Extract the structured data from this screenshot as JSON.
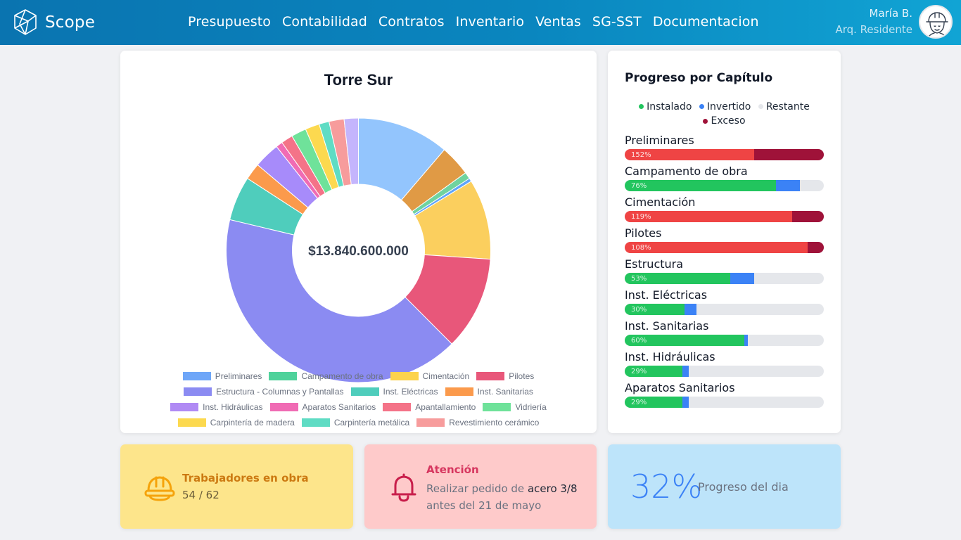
{
  "app": {
    "name": "Scope"
  },
  "nav": [
    "Presupuesto",
    "Contabilidad",
    "Contratos",
    "Inventario",
    "Ventas",
    "SG-SST",
    "Documentacion"
  ],
  "user": {
    "name": "María B.",
    "role": "Arq. Residente",
    "avatar_icon": "worker-helmet-avatar-icon"
  },
  "chart_data": {
    "type": "pie",
    "title": "Torre Sur",
    "center_label": "$13.840.600.000",
    "categories": [
      "Preliminares",
      "Campamento de obra",
      "Cimentación",
      "Pilotes",
      "Estructura - Columnas y Pantallas",
      "Inst. Eléctricas",
      "Inst. Sanitarias",
      "Inst. Hidráulicas",
      "Aparatos Sanitarios",
      "Apantallamiento",
      "Vidriería",
      "Carpintería de madera",
      "Carpintería metálica",
      "Revestimiento cerámico"
    ],
    "colors": [
      "#60a5fa",
      "#34d399",
      "#fcd34d",
      "#e8577a",
      "#8b8bf2",
      "#4fcdbc",
      "#fb9a4c",
      "#b08af4",
      "#f06bb4",
      "#f47388",
      "#6fe29a",
      "#fcd94f",
      "#5fdcc4",
      "#f79c9c"
    ],
    "slices": [
      {
        "name": "Preliminares",
        "color": "#93c5fd",
        "value": 11.0
      },
      {
        "name": "Campamento de obra",
        "color": "#e09a45",
        "value": 3.7
      },
      {
        "name": "Cimentación",
        "color": "#6fd39f",
        "value": 0.8
      },
      {
        "name": "Pilotes",
        "color": "#60a5fa",
        "value": 0.4
      },
      {
        "name": "Estructura - Columnas y Pantallas",
        "color": "#fbcf5e",
        "value": 9.6
      },
      {
        "name": "Inst. Eléctricas",
        "color": "#e8577a",
        "value": 11.2
      },
      {
        "name": "Inst. Sanitarias",
        "color": "#8b8bf2",
        "value": 40.3
      },
      {
        "name": "Inst. Hidráulicas",
        "color": "#4fcdbc",
        "value": 5.3
      },
      {
        "name": "Aparatos Sanitarios",
        "color": "#fb9a4c",
        "value": 2.0
      },
      {
        "name": "Apantallamiento",
        "color": "#a78bfa",
        "value": 3.1
      },
      {
        "name": "Vidriería",
        "color": "#f06bb4",
        "value": 0.8
      },
      {
        "name": "Carpintería de madera",
        "color": "#f47388",
        "value": 1.4
      },
      {
        "name": "Carpintería metálica",
        "color": "#6fe29a",
        "value": 1.8
      },
      {
        "name": "Revestimiento cerámico",
        "color": "#fcd94f",
        "value": 1.7
      },
      {
        "name": "Preliminares",
        "color": "#5fdcc4",
        "value": 1.2
      },
      {
        "name": "Campamento de obra",
        "color": "#f79c9c",
        "value": 1.8
      },
      {
        "name": "Cimentación",
        "color": "#c4b5fd",
        "value": 1.7
      }
    ]
  },
  "progress": {
    "title": "Progreso por Capítulo",
    "legend": [
      {
        "label": "Instalado",
        "color": "#22c55e"
      },
      {
        "label": "Invertido",
        "color": "#3b82f6"
      },
      {
        "label": "Restante",
        "color": "#e5e7eb"
      },
      {
        "label": "Exceso",
        "color": "#9f1239"
      }
    ],
    "chapters": [
      {
        "name": "Preliminares",
        "label": "152%",
        "installed": 65,
        "invested": 0,
        "excess": 35,
        "over": true
      },
      {
        "name": "Campamento de obra",
        "label": "76%",
        "installed": 76,
        "invested": 12,
        "excess": 0,
        "over": false
      },
      {
        "name": "Cimentación",
        "label": "119%",
        "installed": 84,
        "invested": 0,
        "excess": 16,
        "over": true
      },
      {
        "name": "Pilotes",
        "label": "108%",
        "installed": 92,
        "invested": 0,
        "excess": 8,
        "over": true
      },
      {
        "name": "Estructura",
        "label": "53%",
        "installed": 53,
        "invested": 12,
        "excess": 0,
        "over": false
      },
      {
        "name": "Inst. Eléctricas",
        "label": "30%",
        "installed": 30,
        "invested": 6,
        "excess": 0,
        "over": false
      },
      {
        "name": "Inst. Sanitarias",
        "label": "60%",
        "installed": 60,
        "invested": 2,
        "excess": 0,
        "over": false
      },
      {
        "name": "Inst. Hidráulicas",
        "label": "29%",
        "installed": 29,
        "invested": 3,
        "excess": 0,
        "over": false
      },
      {
        "name": "Aparatos Sanitarios",
        "label": "29%",
        "installed": 29,
        "invested": 3,
        "excess": 0,
        "over": false
      }
    ]
  },
  "workers": {
    "title": "Trabajadores en obra",
    "count": "54 / 62",
    "icon": "hard-hat-icon"
  },
  "alert": {
    "title": "Atención",
    "text_before": "Realizar pedido de ",
    "highlight": "acero 3/8",
    "text_after": " antes del 21 de mayo",
    "icon": "bell-icon"
  },
  "daily": {
    "value": "32%",
    "label": "Progreso del dia"
  }
}
